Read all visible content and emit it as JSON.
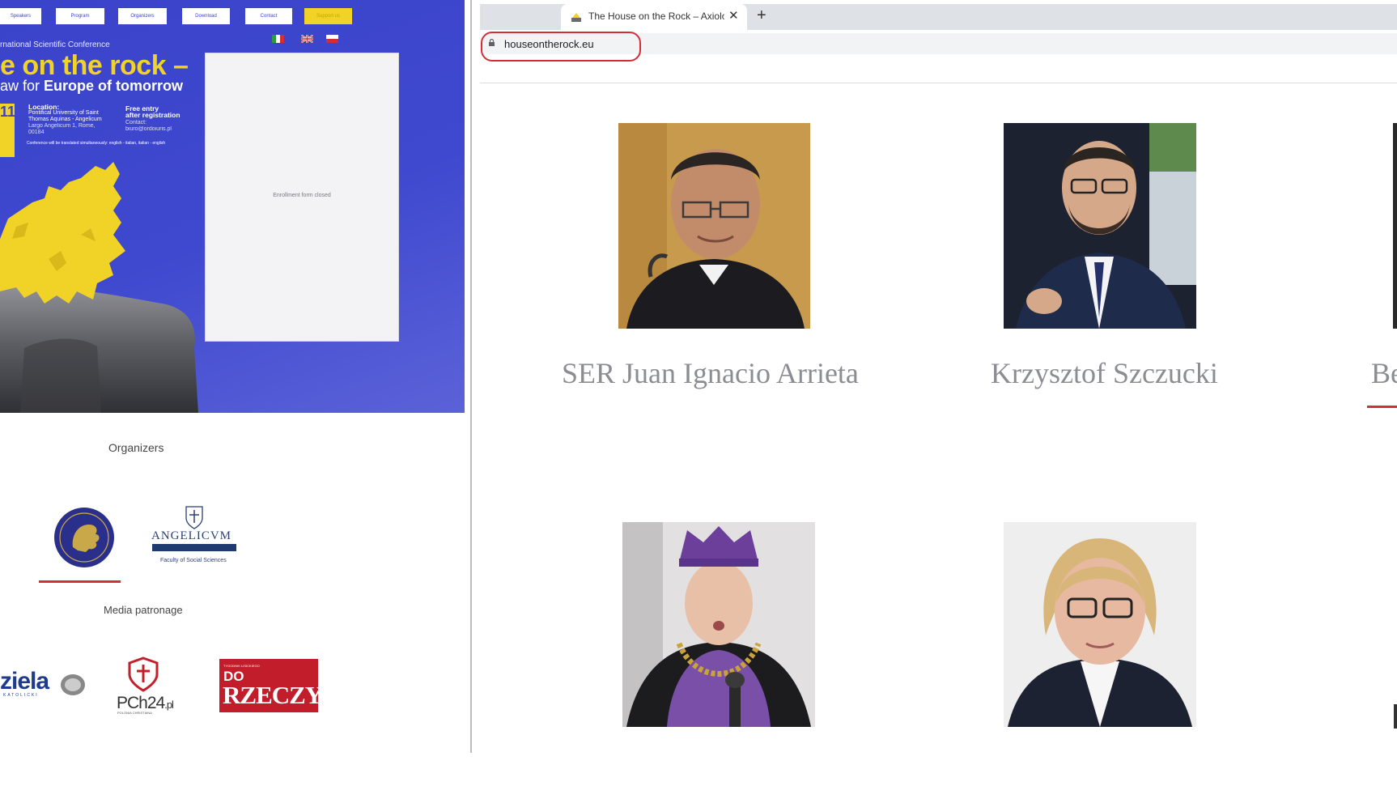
{
  "left": {
    "nav": [
      "Speakers",
      "Program",
      "Organizers",
      "Download",
      "Contact",
      "Support us"
    ],
    "conference_label": "rnational Scientific Conference",
    "title_line1": "e on the rock –",
    "title_line2_a": "aw for ",
    "title_line2_b": "Europe of tomorrow",
    "date_fragment": "11",
    "location_heading": "Location:",
    "location_lines": [
      "Pontifical University of Saint",
      "Thomas Aquinas - Angelicum",
      "Largo Angelicum 1, Rome, 00184"
    ],
    "entry_heading": "Free entry",
    "entry_sub": "after registration",
    "contact_label": "Contact:",
    "contact_email": "biuro@ordoiuris.pl",
    "translation_note": "Conference will be translated simultaneously: english - italian, italian - english",
    "form_status": "Enrollment form closed",
    "organizers_title": "Organizers",
    "angelicum_name": "ANGELICVM",
    "angelicum_sub": "Faculty of Social Sciences",
    "media_title": "Media patronage",
    "media_logos": [
      "ziela",
      "KATOLICKI",
      "PCh24",
      ".pl",
      "POLONIA CHRISTIANA",
      "TYGODNIK LISICKIEGO",
      "DO",
      "RZECZY"
    ]
  },
  "browser": {
    "tab_title": "The House on the Rock – Axiology of law for Europe of tomorrow",
    "url": "houseontherock.eu"
  },
  "speakers": [
    {
      "name": "SER Juan Ignacio Arrieta"
    },
    {
      "name": "Krzysztof Szczucki"
    },
    {
      "name": "Be"
    }
  ],
  "colors": {
    "banner_blue": "#3a43c9",
    "accent_yellow": "#f1d226",
    "annotation_red": "#d42d3a",
    "speaker_name_gray": "#8b8d92"
  }
}
